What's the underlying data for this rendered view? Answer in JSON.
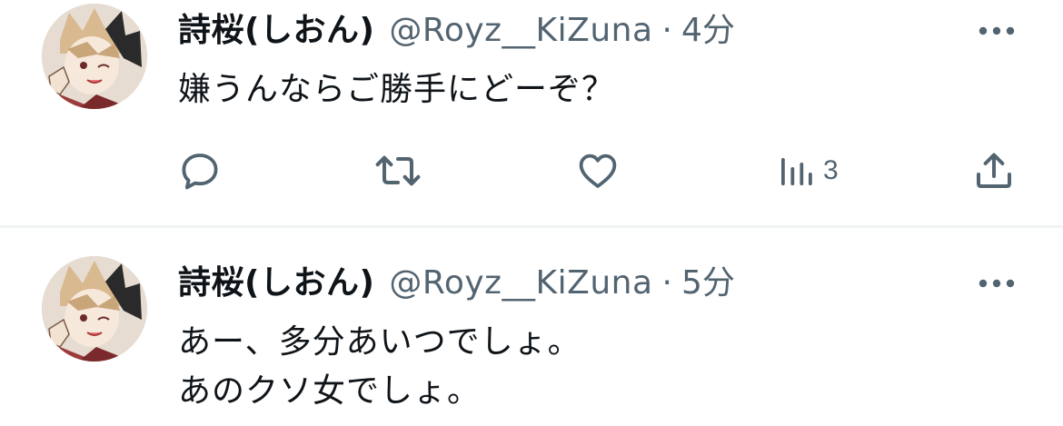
{
  "tweets": [
    {
      "display_name": "詩桜(しおん)",
      "handle": "@Royz__KiZuna",
      "separator": "·",
      "time": "4分",
      "lines": [
        "嫌うんならご勝手にどーぞ？"
      ],
      "actions": {
        "reply_icon": "reply-icon",
        "retweet_icon": "retweet-icon",
        "like_icon": "heart-icon",
        "views_icon": "views-chart-icon",
        "views_count": "3",
        "share_icon": "share-icon"
      }
    },
    {
      "display_name": "詩桜(しおん)",
      "handle": "@Royz__KiZuna",
      "separator": "·",
      "time": "5分",
      "lines": [
        "あー、多分あいつでしょ。",
        "あのクソ女でしょ。"
      ]
    }
  ],
  "colors": {
    "text": "#0f1419",
    "secondary": "#536471",
    "divider": "#eff3f4"
  }
}
